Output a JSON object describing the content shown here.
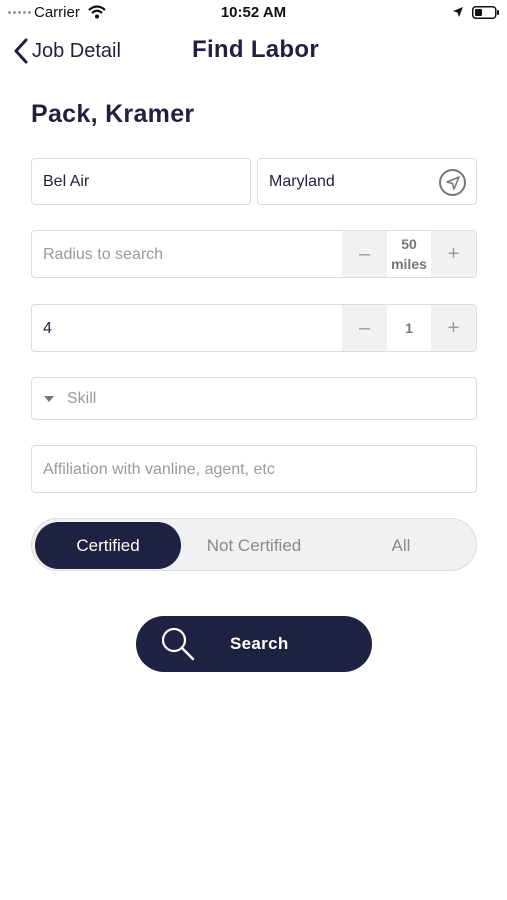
{
  "status_bar": {
    "carrier": "Carrier",
    "time": "10:52 AM"
  },
  "nav": {
    "back_label": "Job Detail",
    "title": "Find Labor"
  },
  "person_name": "Pack, Kramer",
  "location": {
    "city": "Bel Air",
    "state": "Maryland"
  },
  "radius": {
    "placeholder": "Radius to search",
    "value": "50",
    "unit": "miles",
    "minus": "–",
    "plus": "+"
  },
  "count": {
    "value": "4",
    "stepper_value": "1",
    "minus": "–",
    "plus": "+"
  },
  "skill": {
    "placeholder": "Skill"
  },
  "affiliation": {
    "placeholder": "Affiliation with vanline, agent, etc"
  },
  "certification_filter": {
    "options": [
      "Certified",
      "Not Certified",
      "All"
    ],
    "selected": "Certified"
  },
  "search_button": {
    "label": "Search"
  },
  "colors": {
    "primary": "#1e2140",
    "border": "#dcdcdc",
    "placeholder": "#9a9a9a",
    "stepper_bg": "#f1f1f1"
  },
  "icons": [
    "wifi-icon",
    "location-arrow-icon",
    "battery-icon",
    "back-chevron-icon",
    "locate-icon",
    "dropdown-caret-icon",
    "search-icon"
  ]
}
